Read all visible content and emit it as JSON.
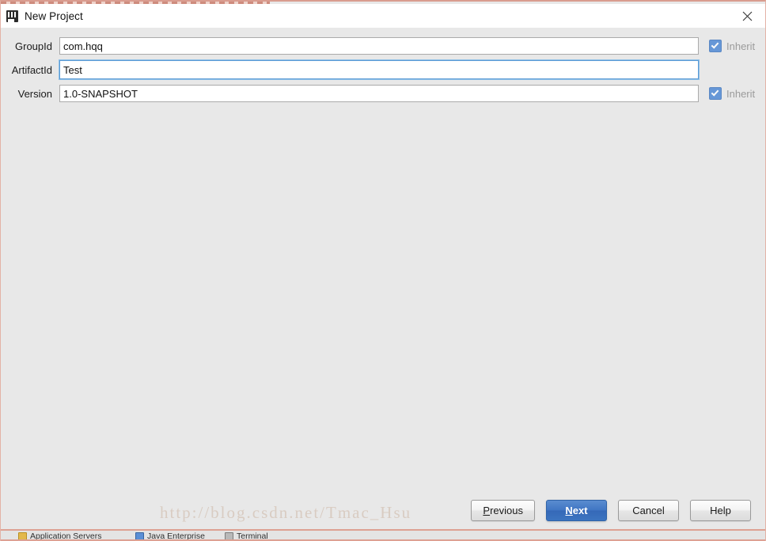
{
  "window": {
    "title": "New Project",
    "logo_icon": "intellij-idea-logo-icon",
    "close_icon": "close-icon"
  },
  "form": {
    "rows": [
      {
        "label": "GroupId",
        "value": "com.hqq",
        "placeholder": "",
        "focused": false,
        "inherit": {
          "label": "Inherit",
          "checked": true,
          "enabled": false
        }
      },
      {
        "label": "ArtifactId",
        "value": "Test",
        "placeholder": "",
        "focused": true,
        "inherit": null
      },
      {
        "label": "Version",
        "value": "1.0-SNAPSHOT",
        "placeholder": "",
        "focused": false,
        "inherit": {
          "label": "Inherit",
          "checked": true,
          "enabled": false
        }
      }
    ]
  },
  "buttons": {
    "previous": {
      "label": "Previous",
      "mnemonic": "P",
      "default": false
    },
    "next": {
      "label": "Next",
      "mnemonic": "N",
      "default": true
    },
    "cancel": {
      "label": "Cancel",
      "mnemonic": "",
      "default": false
    },
    "help": {
      "label": "Help",
      "mnemonic": "",
      "default": false
    }
  },
  "watermark": {
    "text": "http://blog.csdn.net/Tmac_Hsu"
  },
  "ide_status_strip": {
    "items": [
      {
        "label": "Application Servers",
        "icon": "application-servers-icon"
      },
      {
        "label": "Java Enterprise",
        "icon": "java-enterprise-icon"
      },
      {
        "label": "Terminal",
        "icon": "terminal-icon"
      }
    ]
  },
  "colors": {
    "dialog_background": "#e8e8e8",
    "titlebar_background": "#ffffff",
    "accent_blue": "#3c74c0",
    "checkbox_blue": "#4a86d4",
    "focus_ring": "#5b9bd5",
    "disabled_text": "#9b9b9b",
    "crop_border": "#d99c8f"
  }
}
